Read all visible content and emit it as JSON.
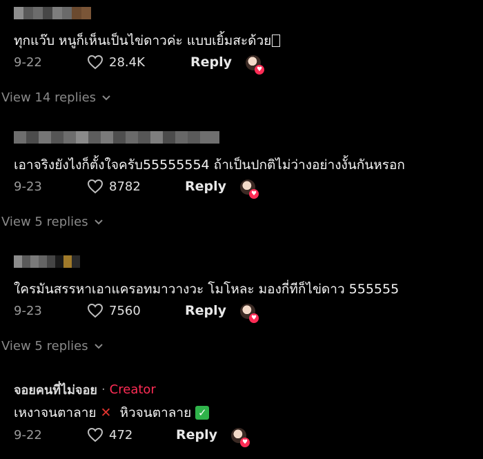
{
  "comments": [
    {
      "text": "ทุกแว๊บ หนูก็เห็นเป็นไข่ดาวค่ะ แบบเยิ้มสะด้วย",
      "date": "9-22",
      "likes": "28.4K",
      "reply_label": "Reply",
      "view_replies": "View 14 replies"
    },
    {
      "text": "เอาจริงยังไงก็ตั้งใจครับ55555554 ถ้าเป็นปกติไม่ว่างอย่างงั้นกันหรอก",
      "date": "9-23",
      "likes": "8782",
      "reply_label": "Reply",
      "view_replies": "View 5 replies"
    },
    {
      "text": "ใครมันสรรหาเอาแครอทมาวางวะ โมโหละ มองกี่ทีก็ไข่ดาว 555555",
      "date": "9-23",
      "likes": "7560",
      "reply_label": "Reply",
      "view_replies": "View 5 replies"
    },
    {
      "author": "จอยคนที่ไม่จอย",
      "separator": "·",
      "creator_tag": "Creator",
      "text_part1": "เหงาจนตาลาย",
      "text_part2": "หิวจนตาลาย",
      "date": "9-22",
      "likes": "472",
      "reply_label": "Reply"
    }
  ],
  "colors": {
    "background": "#000000",
    "creator": "#fe2c55",
    "muted": "#9a9a9a"
  },
  "icons": [
    "heart-outline-icon",
    "chevron-down-icon",
    "creator-liked-avatar-icon",
    "cross-mark-icon",
    "check-mark-icon"
  ]
}
